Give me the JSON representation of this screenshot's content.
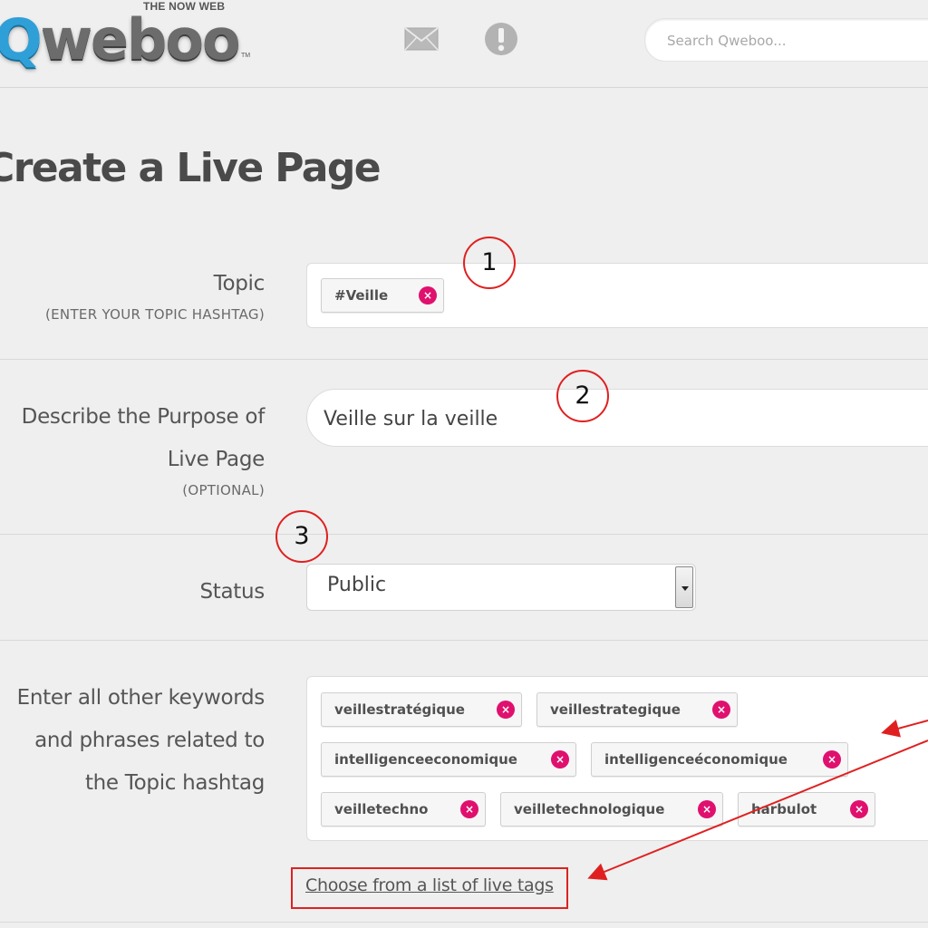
{
  "header": {
    "logo_text": "Qweboo",
    "tagline": "THE NOW WEB",
    "tm": "TM",
    "search_placeholder": "Search Qweboo..."
  },
  "page": {
    "title": "Create a Live Page"
  },
  "topic": {
    "label": "Topic",
    "sublabel": "(ENTER YOUR TOPIC HASHTAG)",
    "tags": [
      "#Veille"
    ]
  },
  "purpose": {
    "label_line1": "Describe the Purpose of",
    "label_line2": "Live Page",
    "sublabel": "(OPTIONAL)",
    "value": "Veille sur la veille"
  },
  "status": {
    "label": "Status",
    "selected": "Public"
  },
  "keywords": {
    "label_line1": "Enter all other keywords",
    "label_line2": "and phrases related to",
    "label_line3": "the Topic hashtag",
    "tags": [
      "veillestratégique",
      "veillestrategique",
      "intelligenceeconomique",
      "intelligenceéconomique",
      "veilletechno",
      "veilletechnologique",
      "harbulot"
    ],
    "choose_link": "Choose from a list of live tags"
  },
  "annotations": {
    "circle_1": "1",
    "circle_2": "2",
    "circle_3": "3",
    "annotation_color": "#e02020"
  },
  "colors": {
    "tag_remove": "#e0106e",
    "logo_q": "#2f9fd8"
  },
  "icons": {
    "tag_remove": "×"
  }
}
